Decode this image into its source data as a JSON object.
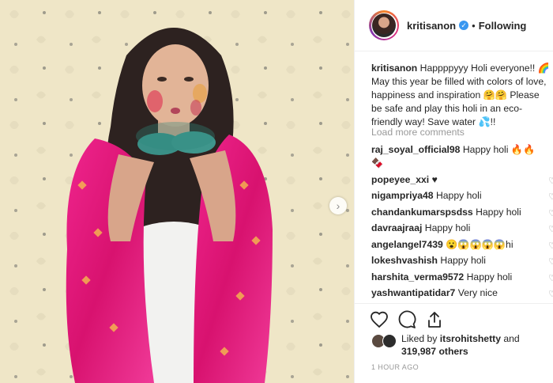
{
  "post": {
    "username": "kritisanon",
    "follow_label": "Following",
    "caption_text": "Happppyyy Holi everyone!! 🌈 May this year be filled with colors of love, happiness and inspiration 🤗🤗 Please be safe and play this holi in an eco-friendly way! Save water 💦!!"
  },
  "load_more": "Load more comments",
  "comments": [
    {
      "user": "raj_soyal_official98",
      "text": "Happy holi 🔥🔥",
      "text2": "🍫"
    },
    {
      "user": "popeyee_xxi",
      "text": "♥"
    },
    {
      "user": "nigampriya48",
      "text": "Happy holi"
    },
    {
      "user": "chandankumarspsdss",
      "text": "Happy holi"
    },
    {
      "user": "davraajraaj",
      "text": "Happy holi"
    },
    {
      "user": "angelangel7439",
      "text": "😮😱😱😱😱hi"
    },
    {
      "user": "lokeshvashish",
      "text": "Happy holi"
    },
    {
      "user": "harshita_verma9572",
      "text": "Happy holi"
    },
    {
      "user": "yashwantipatidar7",
      "text": "Very nice"
    }
  ],
  "likes": {
    "prefix": "Liked by ",
    "user": "itsrohitshetty",
    "suffix": " and",
    "count": "319,987 others"
  },
  "time": "1 HOUR AGO",
  "icons": {
    "verified": "verified-badge-icon",
    "like": "heart-outline-icon",
    "comment": "comment-bubble-icon",
    "share": "share-icon",
    "next": "chevron-right-icon"
  },
  "colors": {
    "verified": "#3897f0",
    "muted": "#999999",
    "dupatta": "#e8208a"
  }
}
